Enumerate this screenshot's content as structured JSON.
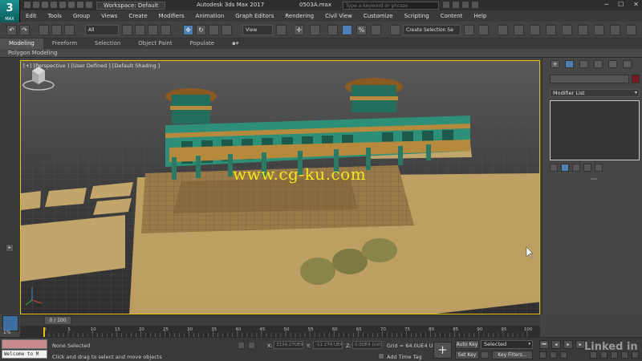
{
  "titlebar": {
    "logo_text": "3",
    "logo_sub": "MAX",
    "workspace": "Workspace: Default",
    "app_title": "Autodesk 3ds Max 2017",
    "file_name": "0503A.max",
    "search_placeholder": "Type a keyword or phrase",
    "minimize": "─",
    "maximize": "☐",
    "close": "✕"
  },
  "menu": [
    "Edit",
    "Tools",
    "Group",
    "Views",
    "Create",
    "Modifiers",
    "Animation",
    "Graph Editors",
    "Rendering",
    "Civil View",
    "Customize",
    "Scripting",
    "Content",
    "Help"
  ],
  "toolbar": {
    "filter": "All",
    "ref_coord": "View",
    "selection_set": "Create Selection Se",
    "percent_icon": "%"
  },
  "ribbon": {
    "tabs": [
      "Modeling",
      "Freeform",
      "Selection",
      "Object Paint",
      "Populate"
    ],
    "panel_label": "Polygon Modeling"
  },
  "viewport": {
    "label": "[+] [Perspective ] [User Defined ] [Default Shading ]",
    "watermark": "www.cg-ku.com"
  },
  "command_panel": {
    "modifier_list": "Modifier List",
    "object_color": "#7a1a22"
  },
  "timeline": {
    "frame": "0 / 100",
    "ticks": [
      0,
      5,
      10,
      15,
      20,
      25,
      30,
      35,
      40,
      45,
      50,
      55,
      60,
      65,
      70,
      75,
      80,
      85,
      90,
      95,
      100
    ],
    "key_level": "1%"
  },
  "status": {
    "maxscript": "Welcome to M",
    "selection": "None Selected",
    "prompt": "Click and drag to select and move objects",
    "x_label": "X:",
    "x_value": "3134.27UE4 Ui",
    "y_label": "Y:",
    "y_value": "-11.274 UE4",
    "z_label": "Z:",
    "z_value": "0.0UE4 Unit",
    "grid": "Grid = 64.0UE4 Unit",
    "add_time_tag": "Add Time Tag",
    "auto_key": "Auto Key",
    "set_key": "Set Key",
    "selected": "Selected",
    "key_filters": "Key Filters...",
    "brand": "Linked in"
  },
  "colors": {
    "accent": "#4d7fb3",
    "viewport_border": "#e8c400",
    "watermark": "#f5e61a"
  }
}
